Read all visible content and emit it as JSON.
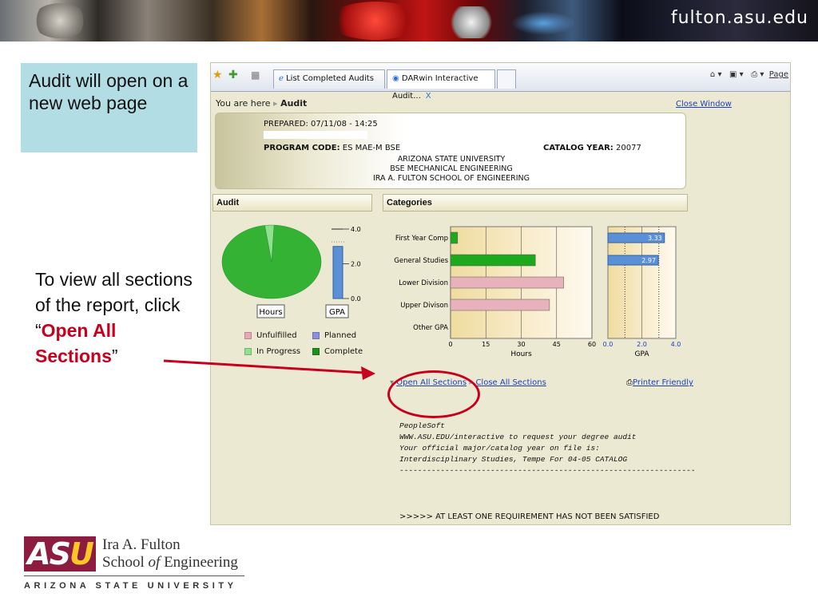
{
  "banner": {
    "brand": "fulton.asu.edu"
  },
  "callouts": {
    "note_text": "Audit will open on a new web page",
    "tip_prefix": "To view all sections of the report, click “",
    "tip_highlight": "Open All Sections",
    "tip_suffix": "”"
  },
  "browser": {
    "tabs": [
      {
        "label": "List Completed Audits"
      },
      {
        "label": "DARwin Interactive Audit...",
        "close": "X"
      }
    ],
    "tools": {
      "page_label": "Page"
    }
  },
  "audit": {
    "breadcrumb_prefix": "You are here",
    "breadcrumb_current": "Audit",
    "close_window": "Close Window",
    "prepared": "PREPARED: 07/11/08 - 14:25",
    "program_code_label": "PROGRAM CODE:",
    "program_code_value": "ES MAE-M BSE",
    "catalog_year_label": "CATALOG YEAR:",
    "catalog_year_value": "20077",
    "university": "ARIZONA STATE UNIVERSITY",
    "degree": "BSE MECHANICAL ENGINEERING",
    "school": "IRA A. FULTON SCHOOL OF ENGINEERING",
    "audit_section": "Audit",
    "categories_section": "Categories",
    "hours_button": "Hours",
    "gpa_button": "GPA",
    "legend": [
      {
        "label": "Unfulfilled",
        "color": "#e8a9b4"
      },
      {
        "label": "Planned",
        "color": "#8b8fe0"
      },
      {
        "label": "In Progress",
        "color": "#8fe08f"
      },
      {
        "label": "Complete",
        "color": "#1d8f1d"
      }
    ],
    "open_all": "Open All Sections",
    "close_all": "Close All Sections",
    "printer": "Printer Friendly",
    "notes": [
      "PeopleSoft",
      "WWW.ASU.EDU/interactive to request your degree audit",
      "Your official major/catalog year on file is:",
      "Interdisciplinary Studies, Tempe For 04-05 CATALOG",
      "-----------------------------------------------------------------"
    ],
    "warning": ">>>>> AT LEAST ONE REQUIREMENT HAS NOT BEEN SATISFIED"
  },
  "chart_data": [
    {
      "type": "pie",
      "categories": [
        "Complete",
        "In Progress"
      ],
      "values": [
        97,
        3
      ]
    },
    {
      "type": "bar",
      "orientation": "vertical",
      "categories": [
        "GPA"
      ],
      "values": [
        3.0
      ],
      "yticks": [
        "4.0",
        "2.0",
        "0.0"
      ],
      "ylim": [
        0,
        4
      ]
    },
    {
      "type": "bar",
      "orientation": "horizontal",
      "categories": [
        "First Year Comp",
        "General Studies",
        "Lower Division",
        "Upper Divison",
        "Other GPA"
      ],
      "series": [
        {
          "name": "Complete",
          "values": [
            3,
            36,
            0,
            0,
            0
          ]
        },
        {
          "name": "Unfulfilled",
          "values": [
            0,
            0,
            48,
            42,
            0
          ]
        }
      ],
      "xlabel": "Hours",
      "xticks": [
        "0",
        "15",
        "30",
        "45",
        "60"
      ],
      "xlim": [
        0,
        60
      ]
    },
    {
      "type": "bar",
      "orientation": "horizontal",
      "categories": [
        "First Year Comp",
        "General Studies",
        "Lower Division",
        "Upper Divison",
        "Other GPA"
      ],
      "values": [
        3.33,
        2.97,
        null,
        null,
        null
      ],
      "data_labels": [
        "3.33",
        "2.97"
      ],
      "xlabel": "GPA",
      "xticks": [
        "0.0",
        "2.0",
        "4.0"
      ],
      "xlim": [
        0,
        4
      ]
    }
  ]
}
